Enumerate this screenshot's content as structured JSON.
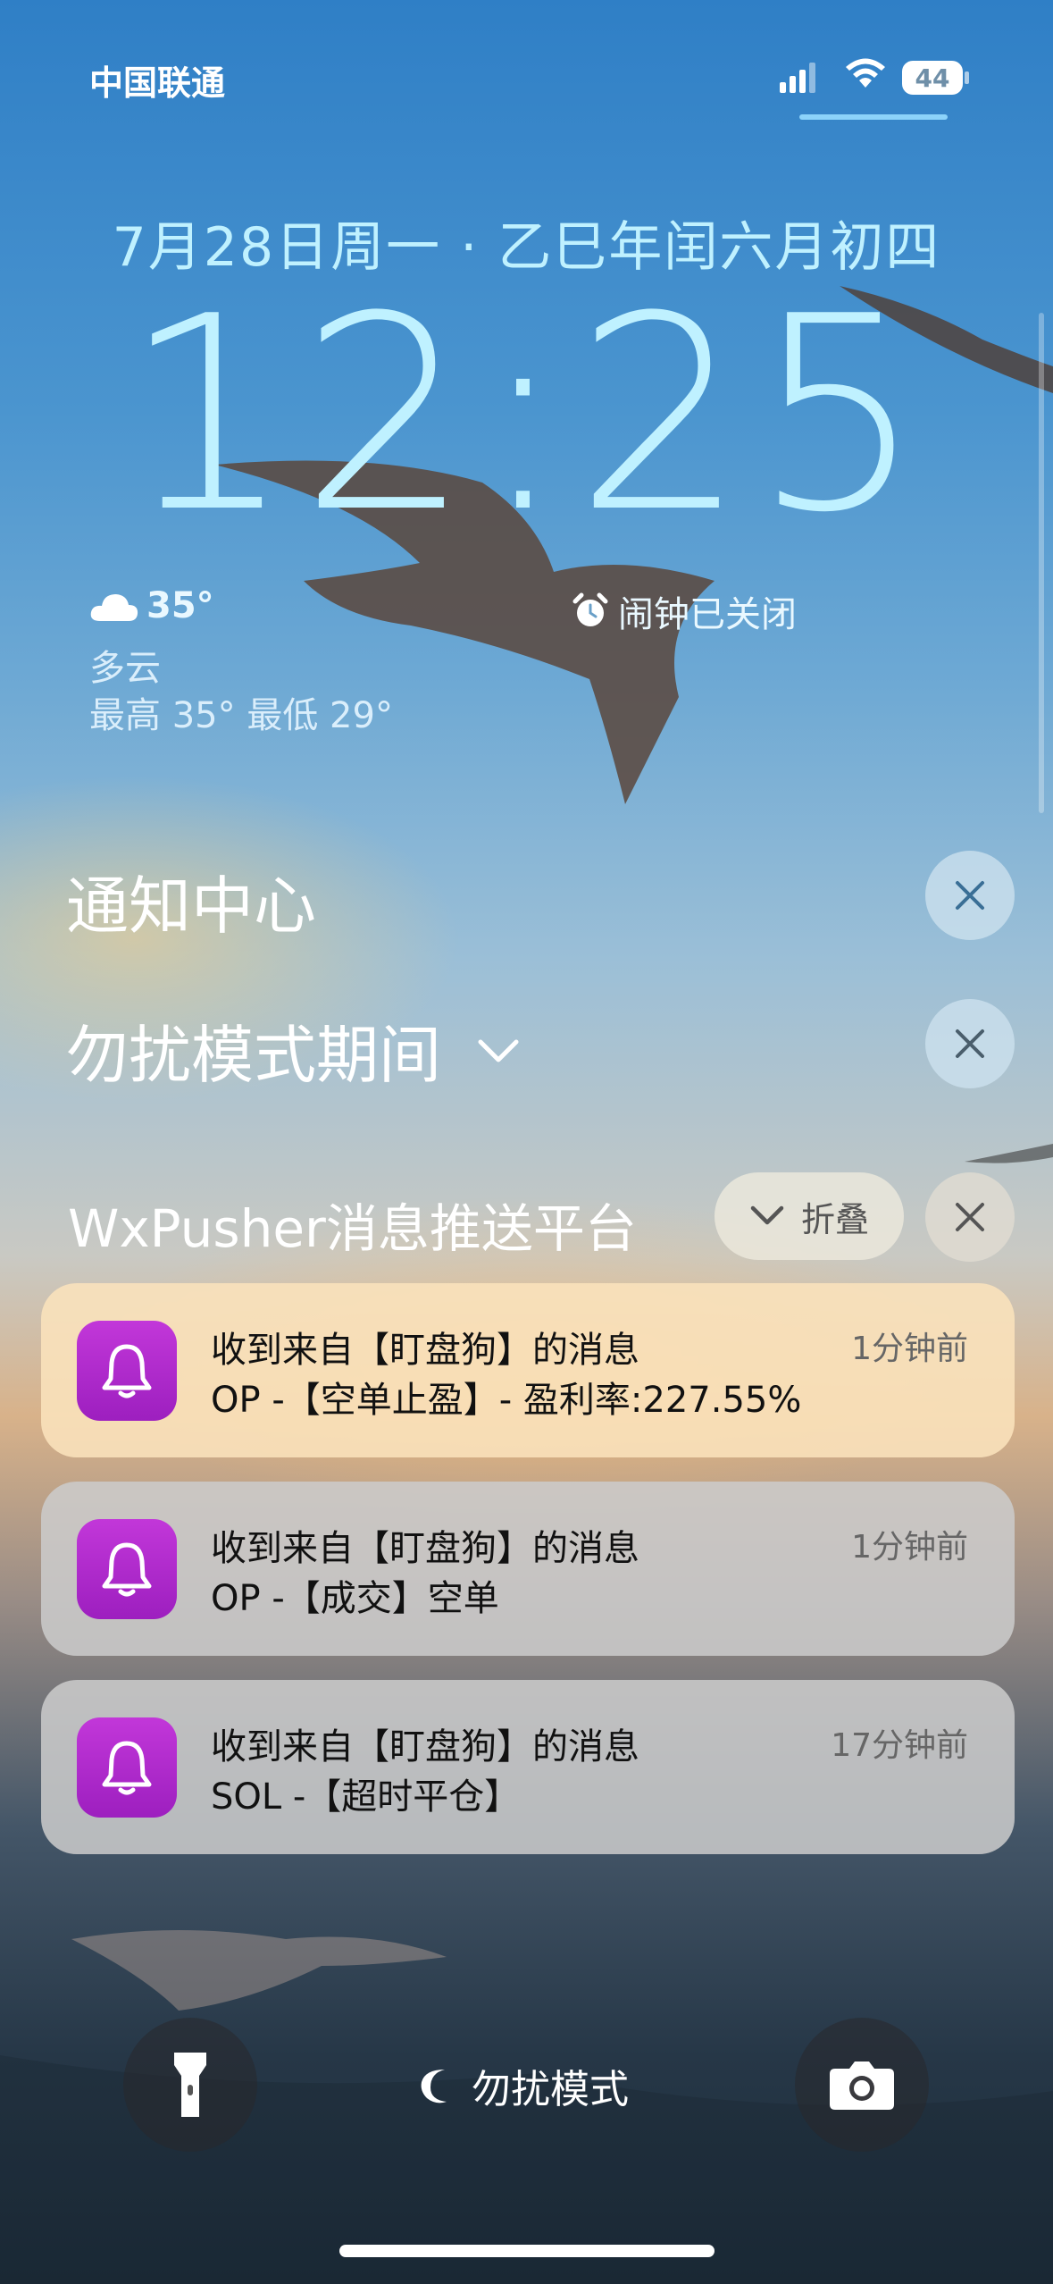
{
  "status_bar": {
    "carrier": "中国联通",
    "battery": "44",
    "signal_icon": "signal-bars-icon",
    "wifi_icon": "wifi-icon"
  },
  "lock_screen": {
    "date": "7月28日周一 · 乙巳年闰六月初四",
    "time": "12:25",
    "weather": {
      "temperature": "35°",
      "condition": "多云",
      "range": "最高 35° 最低 29°",
      "icon": "cloud-icon"
    },
    "alarm": {
      "text": "闹钟已关闭",
      "icon": "alarm-clock-icon"
    }
  },
  "notification_center": {
    "title": "通知中心",
    "focus_section_title": "勿扰模式期间",
    "group": {
      "app_name": "WxPusher消息推送平台",
      "collapse_label": "折叠",
      "notifications": [
        {
          "title": "收到来自【盯盘狗】的消息",
          "body": "OP -【空单止盈】- 盈利率:227.55%",
          "time": "1分钟前"
        },
        {
          "title": "收到来自【盯盘狗】的消息",
          "body": "OP -【成交】空单",
          "time": "1分钟前"
        },
        {
          "title": "收到来自【盯盘狗】的消息",
          "body": "SOL -【超时平仓】",
          "time": "17分钟前"
        }
      ]
    }
  },
  "bottom": {
    "focus_mode": "勿扰模式",
    "flashlight_icon": "flashlight-icon",
    "camera_icon": "camera-icon",
    "moon_icon": "moon-icon"
  },
  "colors": {
    "clock_text": "#bff1ff",
    "app_icon": "#b02ccf"
  }
}
